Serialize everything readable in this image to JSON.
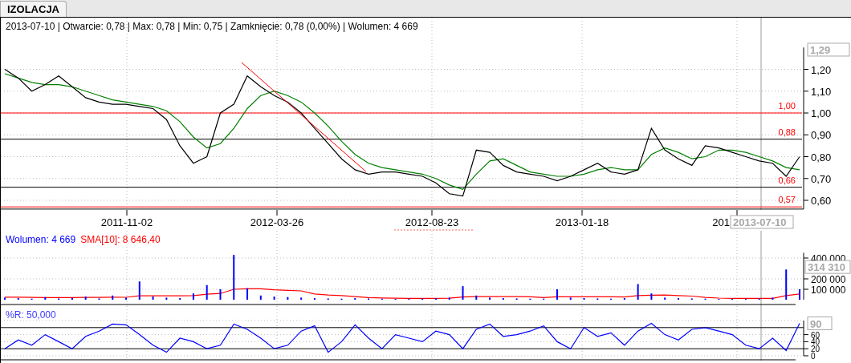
{
  "tabs": [
    {
      "label": "IZOLACJA",
      "selected": true
    }
  ],
  "quote_line": "2013-07-10 | Otwarcie: 0,78 | Max: 0,78 | Min: 0,75 | Zamknięcie: 0,78 (0,00%)  | Wolumen: 4 669",
  "price_chart": {
    "date_labels": [
      "2011-11-02",
      "2012-03-26",
      "2012-08-23",
      "2013-01-18",
      "201"
    ],
    "price_marker": "1,29",
    "cursor_date": "2013-07-10",
    "chart_data": {
      "type": "line",
      "grid": true,
      "ylim": [
        0.56,
        1.3
      ],
      "yticks": [
        {
          "value": 0.6,
          "label": "0,60"
        },
        {
          "value": 0.7,
          "label": "0,70"
        },
        {
          "value": 0.8,
          "label": "0,80"
        },
        {
          "value": 0.9,
          "label": "0,90"
        },
        {
          "value": 1.0,
          "label": "1,00"
        },
        {
          "value": 1.1,
          "label": "1,10"
        },
        {
          "value": 1.2,
          "label": "1,20"
        }
      ],
      "series": [
        {
          "color": "#000000",
          "values": [
            1.2,
            1.16,
            1.1,
            1.13,
            1.17,
            1.12,
            1.07,
            1.05,
            1.04,
            1.04,
            1.03,
            1.02,
            0.97,
            0.85,
            0.77,
            0.8,
            1.0,
            1.04,
            1.17,
            1.12,
            1.08,
            1.05,
            1.0,
            0.93,
            0.86,
            0.79,
            0.74,
            0.72,
            0.73,
            0.73,
            0.72,
            0.71,
            0.68,
            0.63,
            0.62,
            0.83,
            0.82,
            0.76,
            0.73,
            0.72,
            0.71,
            0.69,
            0.71,
            0.74,
            0.77,
            0.73,
            0.72,
            0.74,
            0.93,
            0.83,
            0.79,
            0.76,
            0.85,
            0.84,
            0.82,
            0.8,
            0.78,
            0.77,
            0.71,
            0.8
          ]
        },
        {
          "color": "#008000",
          "values": [
            1.18,
            1.16,
            1.14,
            1.13,
            1.13,
            1.12,
            1.1,
            1.08,
            1.06,
            1.05,
            1.04,
            1.03,
            1.01,
            0.96,
            0.89,
            0.84,
            0.86,
            0.93,
            1.02,
            1.08,
            1.1,
            1.08,
            1.05,
            1.0,
            0.94,
            0.87,
            0.81,
            0.77,
            0.75,
            0.74,
            0.73,
            0.72,
            0.7,
            0.67,
            0.65,
            0.72,
            0.78,
            0.79,
            0.76,
            0.73,
            0.72,
            0.71,
            0.71,
            0.72,
            0.74,
            0.75,
            0.74,
            0.74,
            0.81,
            0.84,
            0.82,
            0.79,
            0.8,
            0.83,
            0.83,
            0.82,
            0.8,
            0.78,
            0.75,
            0.74
          ]
        }
      ],
      "ref_lines": [
        {
          "axis": "y",
          "value": 1.0,
          "label": "1,00",
          "color": "#ff0000"
        },
        {
          "axis": "y",
          "value": 0.88,
          "label": "0,88",
          "color": "#000000"
        },
        {
          "axis": "y",
          "value": 0.66,
          "label": "0,66",
          "color": "#000000"
        },
        {
          "axis": "y",
          "value": 0.57,
          "label": "0,57",
          "color": "#ff0000"
        }
      ]
    }
  },
  "volume_chart": {
    "legend": [
      {
        "text": "Wolumen: 4 669",
        "color": "#0000ff"
      },
      {
        "text": "SMA[10]: 8 646,40",
        "color": "#ff0000"
      }
    ],
    "value_marker": "314 310",
    "chart_data": {
      "type": "bar",
      "grid": true,
      "ylim": [
        0,
        450000
      ],
      "yticks": [
        {
          "value": 100000,
          "label": "100 000"
        },
        {
          "value": 200000,
          "label": "200 000"
        },
        {
          "value": 400000,
          "label": "400 000"
        }
      ],
      "series": [
        {
          "color": "#0000ff",
          "values": [
            20000,
            15000,
            10000,
            25000,
            12000,
            18000,
            30000,
            12000,
            40000,
            20000,
            175000,
            30000,
            20000,
            15000,
            60000,
            140000,
            100000,
            430000,
            110000,
            40000,
            30000,
            25000,
            20000,
            15000,
            12000,
            10000,
            15000,
            12000,
            10000,
            8000,
            10000,
            12000,
            15000,
            20000,
            130000,
            40000,
            20000,
            15000,
            12000,
            10000,
            10000,
            100000,
            20000,
            15000,
            12000,
            10000,
            15000,
            150000,
            60000,
            20000,
            15000,
            12000,
            10000,
            8000,
            10000,
            8000,
            12000,
            20000,
            290000,
            100000
          ]
        },
        {
          "type": "line",
          "color": "#ff0000",
          "values": [
            25000,
            24000,
            22000,
            21000,
            20000,
            20000,
            22000,
            22000,
            24000,
            23000,
            38000,
            38000,
            37000,
            37000,
            40000,
            52000,
            60000,
            100000,
            105000,
            105000,
            95000,
            90000,
            85000,
            55000,
            45000,
            40000,
            30000,
            20000,
            16000,
            14000,
            13000,
            12000,
            13000,
            14000,
            26000,
            29000,
            30000,
            30000,
            29000,
            28000,
            20000,
            28000,
            28000,
            28000,
            28000,
            28000,
            26000,
            40000,
            44000,
            45000,
            40000,
            35000,
            22000,
            15000,
            13000,
            12000,
            12000,
            13000,
            40000,
            55000
          ]
        }
      ]
    }
  },
  "wr_chart": {
    "legend": "%R: 50,000",
    "value_marker": "90",
    "chart_data": {
      "type": "line",
      "grid": true,
      "ylim": [
        0,
        100
      ],
      "yticks": [
        {
          "value": 0,
          "label": "0"
        },
        {
          "value": 20,
          "label": "20"
        },
        {
          "value": 40,
          "label": "40"
        },
        {
          "value": 60,
          "label": "60"
        }
      ],
      "series": [
        {
          "color": "#0000ff",
          "values": [
            20,
            45,
            30,
            60,
            40,
            20,
            55,
            70,
            90,
            88,
            60,
            30,
            10,
            50,
            40,
            20,
            30,
            90,
            75,
            50,
            20,
            30,
            70,
            85,
            10,
            40,
            88,
            50,
            20,
            60,
            50,
            40,
            70,
            60,
            20,
            75,
            90,
            55,
            60,
            70,
            85,
            40,
            20,
            80,
            55,
            65,
            30,
            70,
            92,
            60,
            45,
            75,
            80,
            70,
            60,
            30,
            20,
            50,
            15,
            92
          ]
        }
      ],
      "ref_lines": [
        {
          "axis": "y",
          "value": 80,
          "color": "#000000"
        },
        {
          "axis": "y",
          "value": 20,
          "color": "#000000"
        }
      ]
    }
  }
}
